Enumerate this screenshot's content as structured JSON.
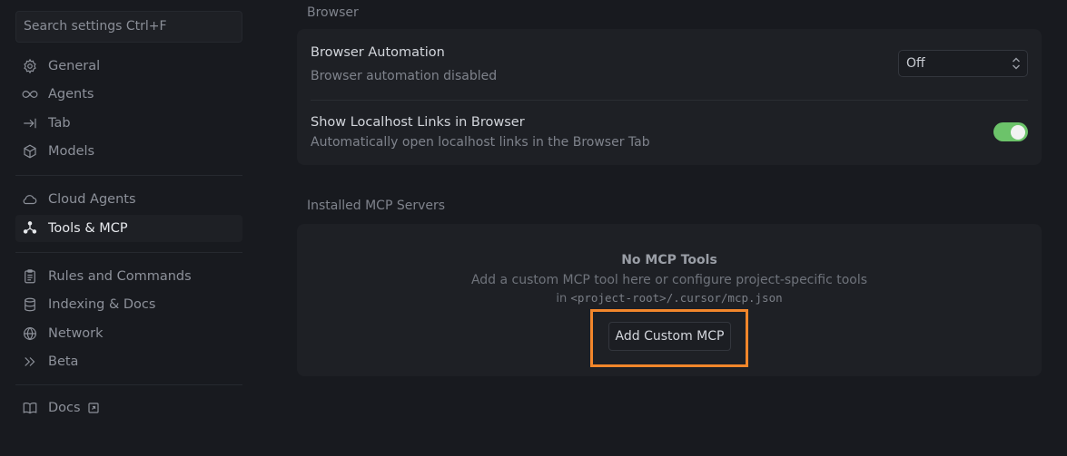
{
  "sidebar": {
    "search_placeholder": "Search settings Ctrl+F",
    "items": [
      {
        "label": "General",
        "icon": "gear-icon"
      },
      {
        "label": "Agents",
        "icon": "infinity-icon"
      },
      {
        "label": "Tab",
        "icon": "arrow-right-bar-icon"
      },
      {
        "label": "Models",
        "icon": "cube-icon"
      },
      {
        "label": "Cloud Agents",
        "icon": "cloud-icon"
      },
      {
        "label": "Tools & MCP",
        "icon": "tools-icon"
      },
      {
        "label": "Rules and Commands",
        "icon": "clipboard-icon"
      },
      {
        "label": "Indexing & Docs",
        "icon": "database-icon"
      },
      {
        "label": "Network",
        "icon": "globe-icon"
      },
      {
        "label": "Beta",
        "icon": "double-chevron-right-icon"
      },
      {
        "label": "Docs",
        "icon": "book-icon"
      }
    ],
    "active_item": "Tools & MCP"
  },
  "browser_section": {
    "title": "Browser",
    "automation": {
      "title": "Browser Automation",
      "subtitle": "Browser automation disabled",
      "select_value": "Off"
    },
    "localhost": {
      "title": "Show Localhost Links in Browser",
      "subtitle": "Automatically open localhost links in the Browser Tab",
      "toggle_on": true
    }
  },
  "mcp_section": {
    "title": "Installed MCP Servers",
    "empty_title": "No MCP Tools",
    "empty_desc": "Add a custom MCP tool here or configure project-specific tools",
    "path_prefix": "in",
    "path_code": "<project-root>/.cursor/mcp.json",
    "add_button": "Add Custom MCP"
  },
  "colors": {
    "background": "#181a1f",
    "card": "#1e2025",
    "toggle_on": "#6cc36a",
    "highlight": "#f2862b"
  }
}
